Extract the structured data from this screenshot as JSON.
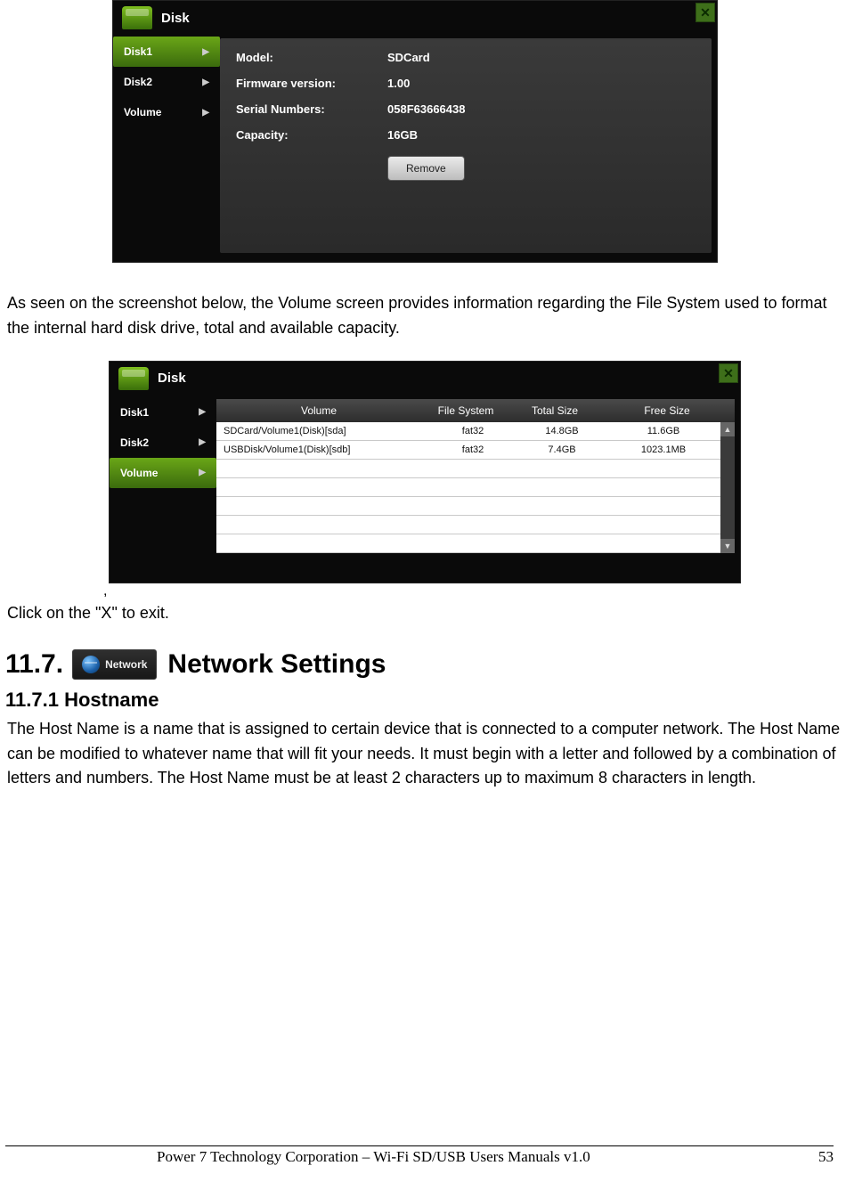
{
  "dialog1": {
    "title": "Disk",
    "close": "✕",
    "sidebar": [
      {
        "label": "Disk1",
        "active": true
      },
      {
        "label": "Disk2",
        "active": false
      },
      {
        "label": "Volume",
        "active": false
      }
    ],
    "rows": [
      {
        "label": "Model:",
        "value": "SDCard"
      },
      {
        "label": "Firmware version:",
        "value": "1.00"
      },
      {
        "label": "Serial Numbers:",
        "value": "058F63666438"
      },
      {
        "label": "Capacity:",
        "value": "16GB"
      }
    ],
    "remove_label": "Remove"
  },
  "para1": "As seen on the screenshot below, the Volume screen provides information regarding the File System used to format the internal hard disk drive, total and available capacity.",
  "dialog2": {
    "title": "Disk",
    "close": "✕",
    "sidebar": [
      {
        "label": "Disk1",
        "active": false
      },
      {
        "label": "Disk2",
        "active": false
      },
      {
        "label": "Volume",
        "active": true
      }
    ],
    "headers": {
      "volume": "Volume",
      "fs": "File System",
      "total": "Total Size",
      "free": "Free Size"
    },
    "rows": [
      {
        "volume": "SDCard/Volume1(Disk)[sda]",
        "fs": "fat32",
        "total": "14.8GB",
        "free": "11.6GB"
      },
      {
        "volume": "USBDisk/Volume1(Disk)[sdb]",
        "fs": "fat32",
        "total": "7.4GB",
        "free": "1023.1MB"
      }
    ],
    "blank_rows": 5
  },
  "comma": ",",
  "para2": "Click on the \"X\" to exit.",
  "section": {
    "number": "11.7.",
    "badge": "Network",
    "title": "Network Settings",
    "sub_number": "11.7.1",
    "sub_title": "Hostname"
  },
  "para3": "The Host Name is a name that is assigned to certain device that is connected to a computer network.   The Host Name can be modified to whatever name that will fit your needs.    It must begin with a letter and followed by a combination of letters and numbers.    The Host Name must be at least 2 characters up to maximum 8 characters in length.",
  "footer": {
    "text": "Power 7 Technology Corporation – Wi-Fi SD/USB Users Manuals v1.0",
    "page": "53"
  }
}
